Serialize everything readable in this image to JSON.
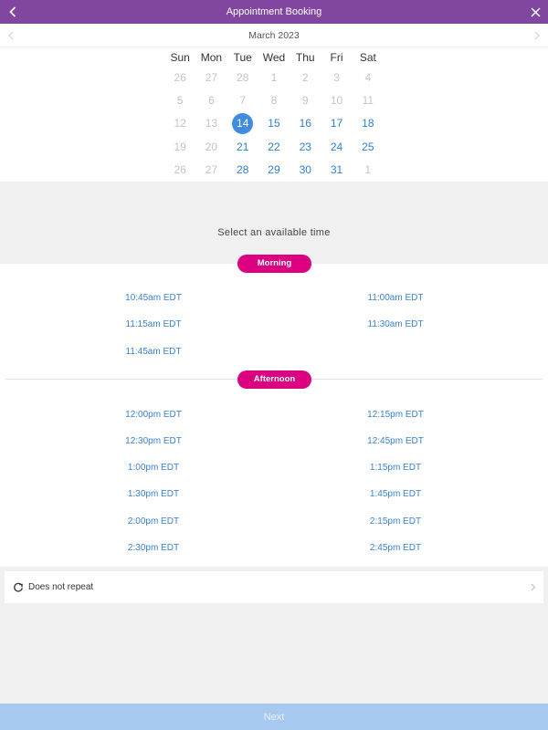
{
  "header": {
    "title": "Appointment Booking",
    "back_icon": "chevron-left-icon",
    "close_icon": "close-icon"
  },
  "calendar": {
    "month_label": "March 2023",
    "prev_icon": "chevron-left-icon",
    "next_icon": "chevron-right-icon",
    "weekdays": [
      "Sun",
      "Mon",
      "Tue",
      "Wed",
      "Thu",
      "Fri",
      "Sat"
    ],
    "weeks": [
      [
        {
          "d": "26",
          "s": "muted"
        },
        {
          "d": "27",
          "s": "muted"
        },
        {
          "d": "28",
          "s": "muted"
        },
        {
          "d": "1",
          "s": "muted"
        },
        {
          "d": "2",
          "s": "muted"
        },
        {
          "d": "3",
          "s": "muted"
        },
        {
          "d": "4",
          "s": "muted"
        }
      ],
      [
        {
          "d": "5",
          "s": "muted"
        },
        {
          "d": "6",
          "s": "muted"
        },
        {
          "d": "7",
          "s": "muted"
        },
        {
          "d": "8",
          "s": "muted"
        },
        {
          "d": "9",
          "s": "muted"
        },
        {
          "d": "10",
          "s": "muted"
        },
        {
          "d": "11",
          "s": "muted"
        }
      ],
      [
        {
          "d": "12",
          "s": "muted"
        },
        {
          "d": "13",
          "s": "muted"
        },
        {
          "d": "14",
          "s": "selected"
        },
        {
          "d": "15",
          "s": "avail"
        },
        {
          "d": "16",
          "s": "avail"
        },
        {
          "d": "17",
          "s": "avail"
        },
        {
          "d": "18",
          "s": "avail"
        }
      ],
      [
        {
          "d": "19",
          "s": "muted"
        },
        {
          "d": "20",
          "s": "muted"
        },
        {
          "d": "21",
          "s": "avail"
        },
        {
          "d": "22",
          "s": "avail"
        },
        {
          "d": "23",
          "s": "avail"
        },
        {
          "d": "24",
          "s": "avail"
        },
        {
          "d": "25",
          "s": "avail"
        }
      ],
      [
        {
          "d": "26",
          "s": "muted"
        },
        {
          "d": "27",
          "s": "muted"
        },
        {
          "d": "28",
          "s": "avail"
        },
        {
          "d": "29",
          "s": "avail"
        },
        {
          "d": "30",
          "s": "avail"
        },
        {
          "d": "31",
          "s": "avail"
        },
        {
          "d": "1",
          "s": "muted"
        }
      ]
    ],
    "colors": {
      "selected": "#3f8ce0",
      "available": "#2f80cf",
      "muted": "#c4c4c4"
    }
  },
  "time_section": {
    "heading": "Select an available time",
    "morning": {
      "label": "Morning",
      "slots": [
        "10:45am EDT",
        "11:00am EDT",
        "11:15am EDT",
        "11:30am EDT",
        "11:45am EDT"
      ]
    },
    "afternoon": {
      "label": "Afternoon",
      "slots": [
        "12:00pm EDT",
        "12:15pm EDT",
        "12:30pm EDT",
        "12:45pm EDT",
        "1:00pm EDT",
        "1:15pm EDT",
        "1:30pm EDT",
        "1:45pm EDT",
        "2:00pm EDT",
        "2:15pm EDT",
        "2:30pm EDT",
        "2:45pm EDT"
      ]
    },
    "pill_color": "#db0080"
  },
  "repeat": {
    "label": "Does not repeat",
    "icon": "repeat-icon",
    "chevron_icon": "chevron-right-icon"
  },
  "footer": {
    "next_label": "Next"
  },
  "theme": {
    "header_bg": "#8046a0",
    "next_bg": "#a7c8ef"
  }
}
